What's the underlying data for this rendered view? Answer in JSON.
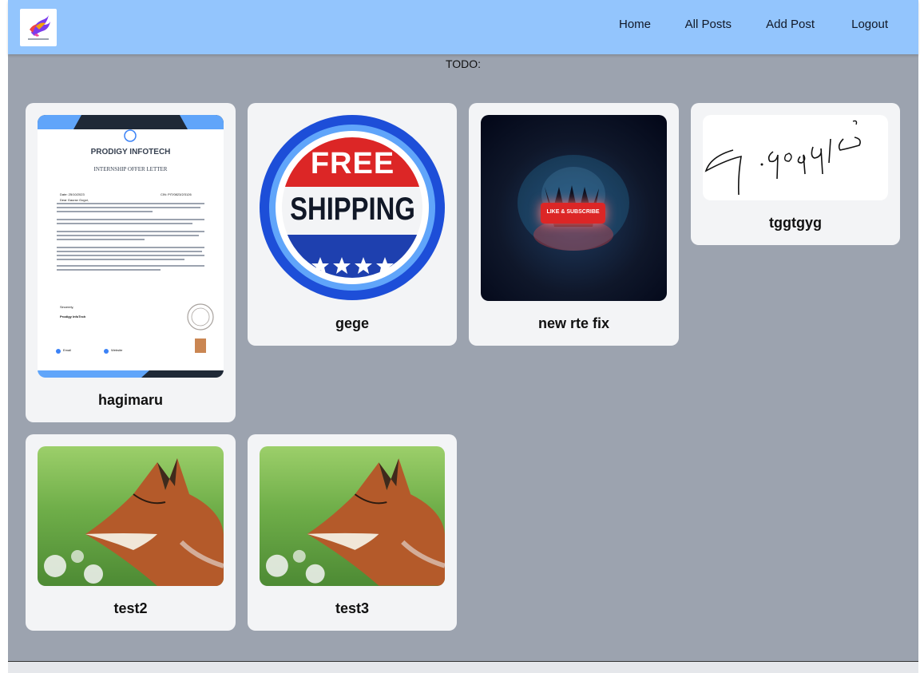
{
  "nav": {
    "logo_name": "logo",
    "links": [
      "Home",
      "All Posts",
      "Add Post",
      "Logout"
    ]
  },
  "todo_label": "TODO:",
  "posts": [
    {
      "title": "hagimaru",
      "image": "offer-letter-image",
      "letter": {
        "company": "PRODIGY INFOTECH",
        "heading": "INTERNSHIP OFFER LETTER",
        "date": "Date: 25/10/2023",
        "cin": "CIN: PIT/0823/2/3126",
        "greeting": "Dear Gaurav Gogoi,",
        "signoff": "Sincerely,",
        "signer": "Prodigy InfoTech",
        "email_label": "Email",
        "website_label": "Website"
      }
    },
    {
      "title": "gege",
      "image": "free-shipping-badge",
      "badge": {
        "line1": "FREE",
        "line2": "SHIPPING"
      }
    },
    {
      "title": "new rte fix",
      "image": "like-subscribe-image",
      "overlay": "LIKE & SUBSCRIBE"
    },
    {
      "title": "tggtgyg",
      "image": "signature-image"
    },
    {
      "title": "test2",
      "image": "fox-photo"
    },
    {
      "title": "test3",
      "image": "fox-photo"
    }
  ],
  "colors": {
    "navbar": "#93c5fd",
    "page_background": "#9ca3af",
    "card": "#f3f4f6"
  }
}
